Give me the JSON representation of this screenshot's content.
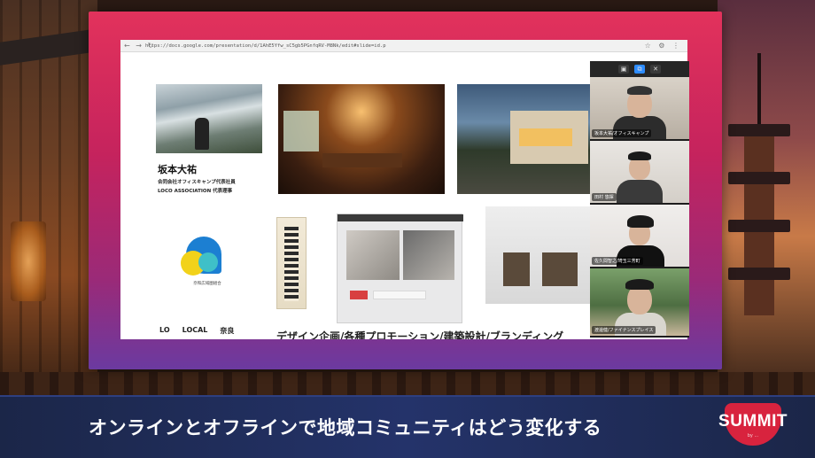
{
  "browser": {
    "url": "https://docs.google.com/presentation/d/1AhE5Yfw_sC5gb5PGnfqRV-M8Nk/edit#slide=id.p",
    "nav_glyphs": "← → ↻",
    "ext_glyphs": "☆ ⚙ ⋮"
  },
  "slide": {
    "profile_name": "坂本大祐",
    "profile_titles": [
      "合同会社オフィスキャンプ代表社員",
      "LOCO ASSOCIATION 代表理事"
    ],
    "logo_caption": "奈和広域圏組合",
    "brand_items": [
      "LO",
      "LOCAL",
      "奈良"
    ],
    "services_text": "デザイン企画/各種プロモーション/建築設計/ブランディング"
  },
  "video_call": {
    "toolbar_buttons": [
      "▣",
      "⧉",
      "✕"
    ],
    "participants": [
      {
        "label": "坂本大祐/オフィスキャンプ"
      },
      {
        "label": "田村 悠揮"
      },
      {
        "label": "佐久間智之/埼玉三芳町"
      },
      {
        "label": "渡邊健/ファイナンスプレイス"
      }
    ]
  },
  "caption": {
    "text": "オンラインとオフラインで地域コミュニティはどう変化する"
  },
  "logo": {
    "word": "SUMMIT",
    "sub": "by ..."
  },
  "colors": {
    "frame_top": "#e2325c",
    "frame_bottom": "#6b3aa0",
    "caption_bar": "#1b2648",
    "summit_red": "#d8233e",
    "zoom_active": "#2d8cff"
  }
}
